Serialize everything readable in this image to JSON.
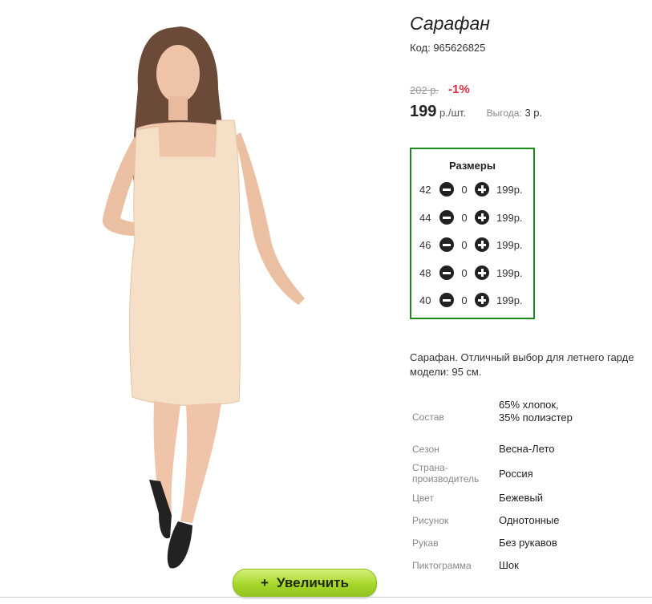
{
  "product": {
    "title": "Сарафан",
    "code": "Код: 965626825",
    "old_price": "202 р.",
    "discount": "-1%",
    "price": "199",
    "price_unit": "р./шт.",
    "benefit_label": "Выгода:",
    "benefit_value": "3 р.",
    "zoom_label": "Увеличить"
  },
  "sizes": {
    "title": "Размеры",
    "rows": [
      {
        "size": "42",
        "qty": "0",
        "price": "199р."
      },
      {
        "size": "44",
        "qty": "0",
        "price": "199р."
      },
      {
        "size": "46",
        "qty": "0",
        "price": "199р."
      },
      {
        "size": "48",
        "qty": "0",
        "price": "199р."
      },
      {
        "size": "40",
        "qty": "0",
        "price": "199р."
      }
    ]
  },
  "description": {
    "line1": "Сарафан. Отличный выбор для летнего гарде",
    "line2": "модели: 95 см."
  },
  "attributes": [
    {
      "key": "Состав",
      "value": "65% хлопок, 35% полиэстер"
    },
    {
      "key": "Сезон",
      "value": "Весна-Лето"
    },
    {
      "key": "Страна-производитель",
      "value": "Россия"
    },
    {
      "key": "Цвет",
      "value": "Бежевый"
    },
    {
      "key": "Рисунок",
      "value": "Однотонные"
    },
    {
      "key": "Рукав",
      "value": "Без рукавов"
    },
    {
      "key": "Пиктограмма",
      "value": "Шок"
    }
  ],
  "colors": {
    "discount": "#e02b3d",
    "sizes_border": "#1a8a1a",
    "zoom_button": "#a5d62a",
    "dress": "#f6dfc7"
  }
}
